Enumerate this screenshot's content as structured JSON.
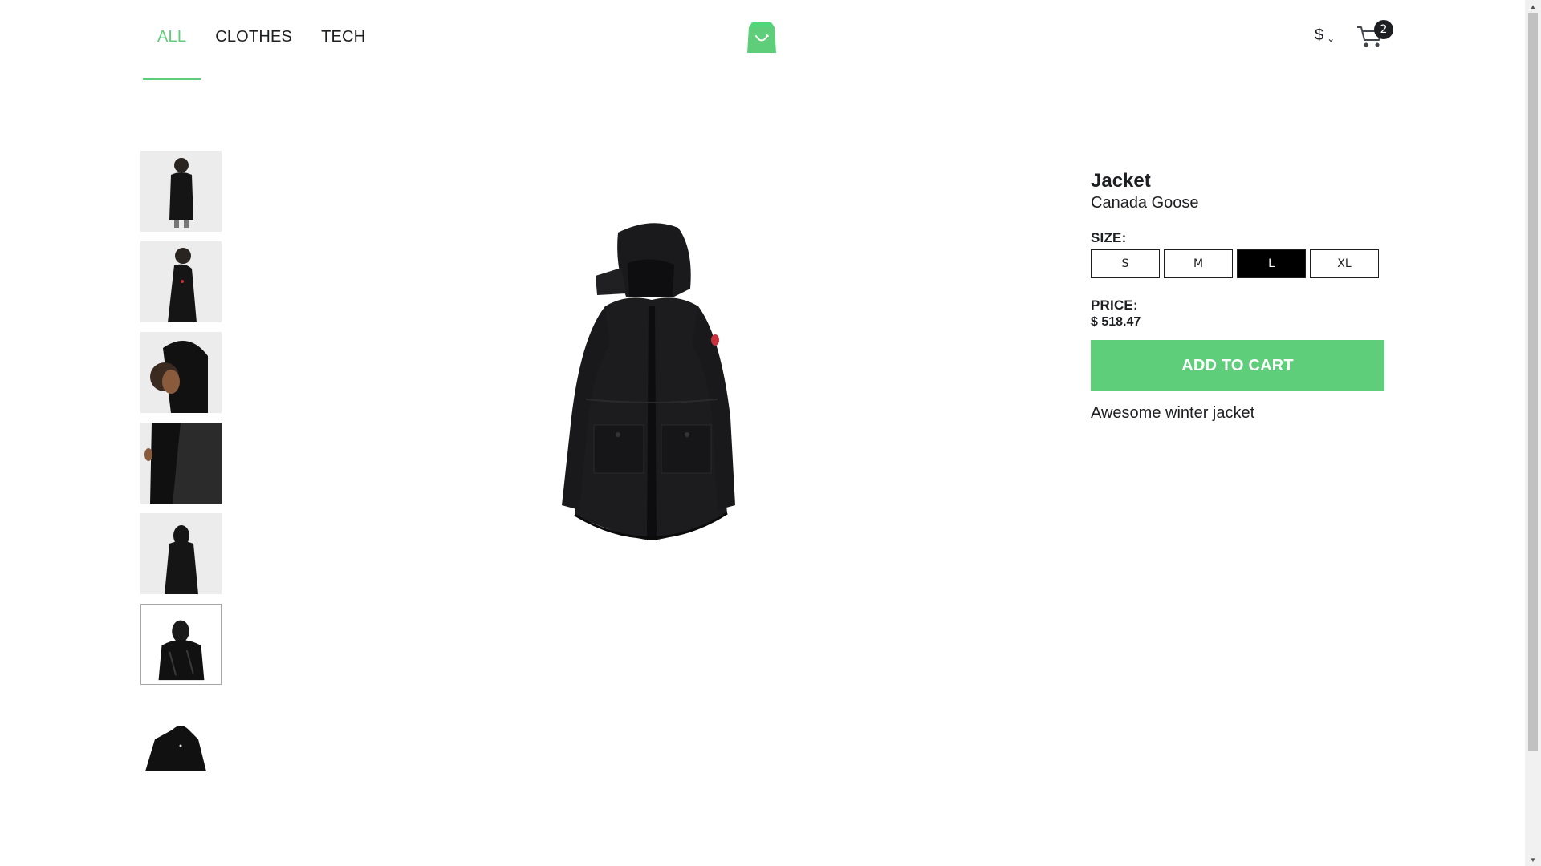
{
  "nav": {
    "items": [
      {
        "label": "ALL",
        "active": true
      },
      {
        "label": "CLOTHES",
        "active": false
      },
      {
        "label": "TECH",
        "active": false
      }
    ]
  },
  "header": {
    "logo_icon": "shopping-bag-icon",
    "currency_symbol": "$",
    "cart_icon": "cart-icon",
    "cart_count": "2"
  },
  "colors": {
    "accent": "#5ece7b",
    "text": "#1d1f22",
    "selected_size_bg": "#000000"
  },
  "gallery": {
    "thumbnails": [
      {
        "alt": "jacket-front-model"
      },
      {
        "alt": "jacket-side-model"
      },
      {
        "alt": "jacket-hood-model"
      },
      {
        "alt": "jacket-detail"
      },
      {
        "alt": "jacket-back"
      },
      {
        "alt": "jacket-hood-flat",
        "selected": true
      },
      {
        "alt": "jacket-flat-top"
      }
    ]
  },
  "product": {
    "name": "Jacket",
    "brand": "Canada Goose",
    "size_label": "SIZE:",
    "sizes": [
      "S",
      "M",
      "L",
      "XL"
    ],
    "selected_size": "L",
    "price_label": "PRICE:",
    "price": "$ 518.47",
    "add_to_cart": "ADD TO CART",
    "description": "Awesome winter jacket"
  }
}
